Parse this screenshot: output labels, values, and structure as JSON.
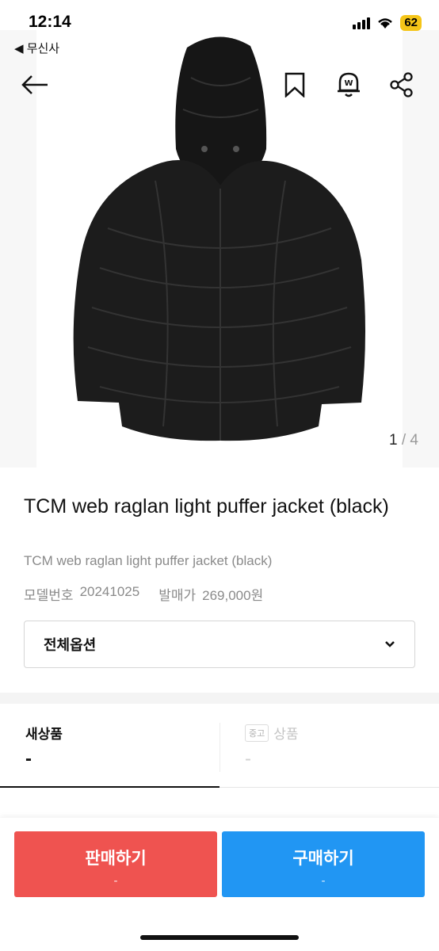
{
  "status": {
    "time": "12:14",
    "battery": "62"
  },
  "back_app": "◀ 무신사",
  "gallery": {
    "current": "1",
    "separator": " / ",
    "total": "4"
  },
  "product": {
    "title": "TCM web raglan light puffer jacket (black)",
    "subtitle": "TCM web raglan light puffer jacket (black)",
    "model_label": "모델번호",
    "model_value": "20241025",
    "price_label": "발매가",
    "price_value": "269,000원"
  },
  "option": {
    "label": "전체옵션"
  },
  "tabs": {
    "new": {
      "title": "새상품",
      "price": "-"
    },
    "used": {
      "badge": "중고",
      "title": "상품",
      "price": "-"
    }
  },
  "actions": {
    "sell": {
      "label": "판매하기",
      "sub": "-"
    },
    "buy": {
      "label": "구매하기",
      "sub": "-"
    }
  },
  "colors": {
    "sell": "#ef5350",
    "buy": "#2196f3"
  },
  "icons": [
    "back-arrow-icon",
    "bookmark-icon",
    "price-alert-bell-icon",
    "share-icon",
    "chevron-down-icon"
  ]
}
